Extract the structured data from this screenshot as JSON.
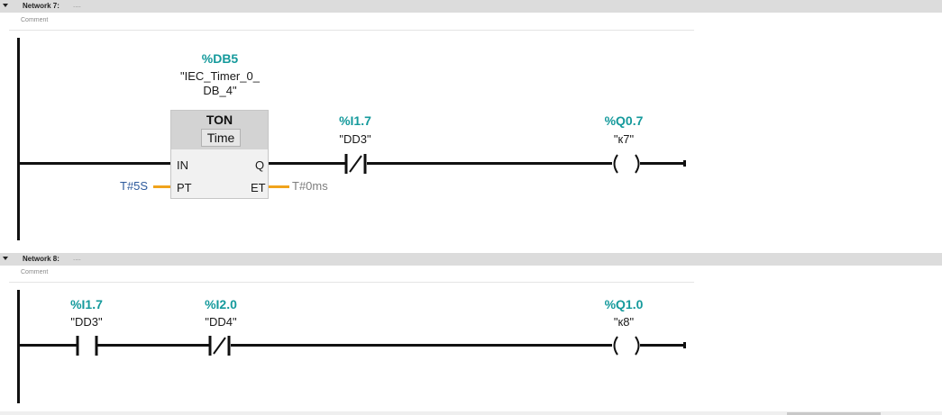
{
  "networks": [
    {
      "title": "Network 7:",
      "dots": "....",
      "comment": "Comment",
      "timer": {
        "db_address": "%DB5",
        "db_name_line1": "\"IEC_Timer_0_",
        "db_name_line2": "DB_4\"",
        "type": "TON",
        "time_type": "Time",
        "pin_in": "IN",
        "pin_q": "Q",
        "pin_pt": "PT",
        "pin_et": "ET",
        "pt_value": "T#5S",
        "et_value": "T#0ms"
      },
      "contact": {
        "address": "%I1.7",
        "tag": "\"DD3\"",
        "kind": "normally-closed"
      },
      "coil": {
        "address": "%Q0.7",
        "tag": "\"к7\""
      }
    },
    {
      "title": "Network 8:",
      "dots": "....",
      "comment": "Comment",
      "contact1": {
        "address": "%I1.7",
        "tag": "\"DD3\"",
        "kind": "normally-open"
      },
      "contact2": {
        "address": "%I2.0",
        "tag": "\"DD4\"",
        "kind": "normally-closed"
      },
      "coil": {
        "address": "%Q1.0",
        "tag": "\"к8\""
      }
    }
  ],
  "colors": {
    "address": "#159a9c",
    "pt_param": "#2d5a9c",
    "et_param": "#7e7e7e",
    "param_wire": "#f0a31c",
    "header_bg": "#dcdcdc"
  }
}
